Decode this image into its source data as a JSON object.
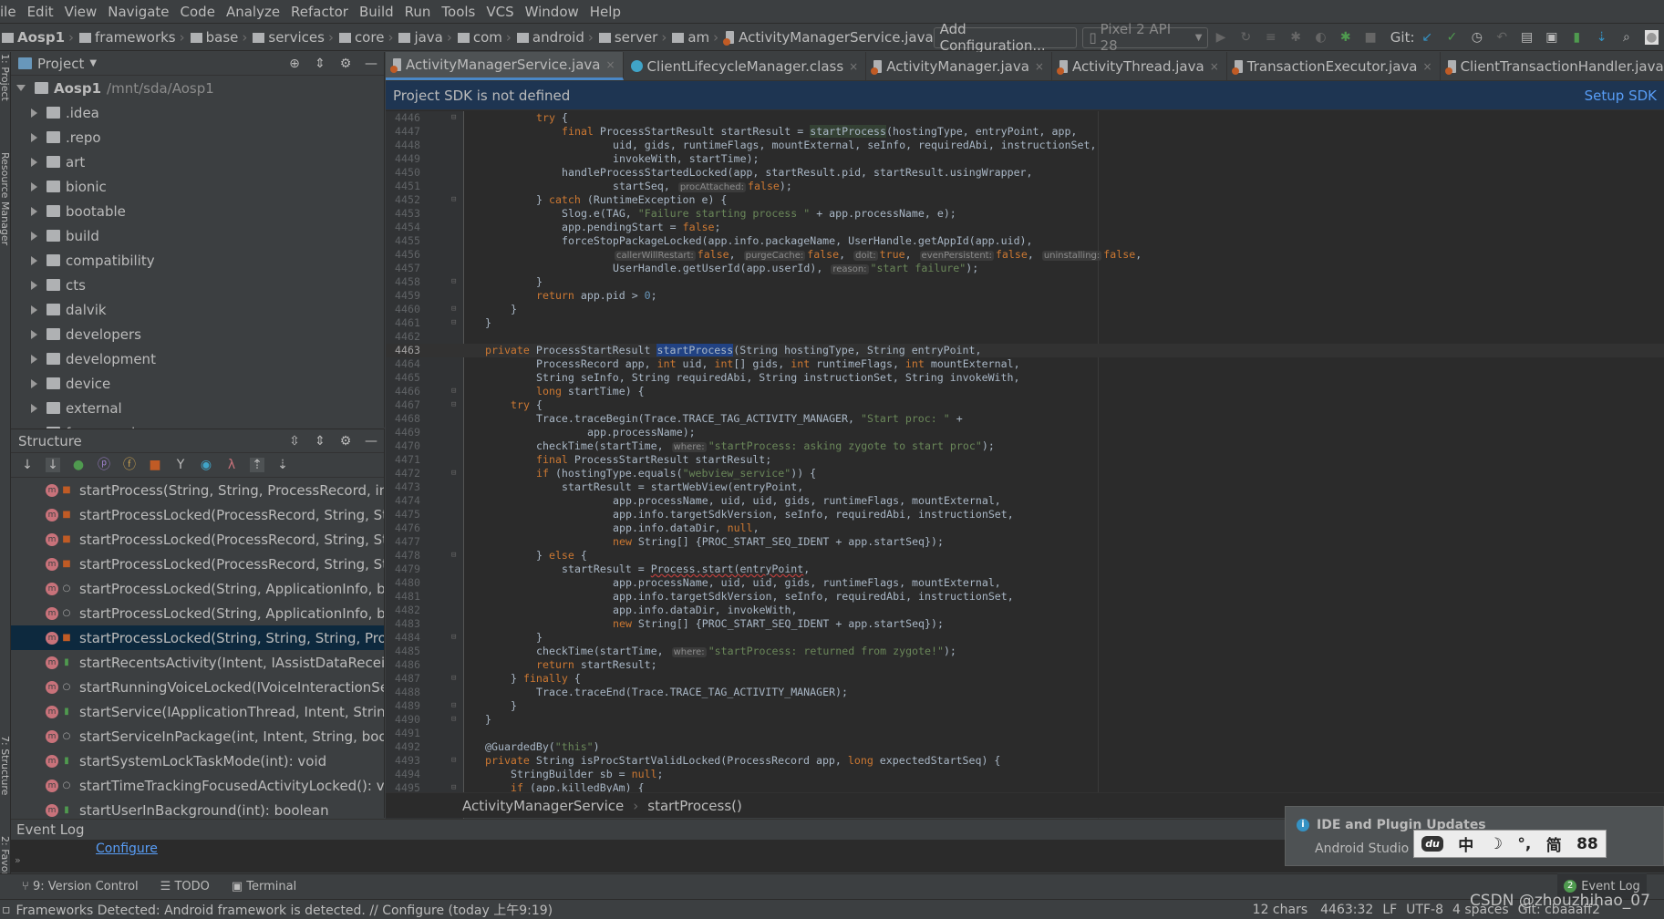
{
  "menu": [
    "ile",
    "Edit",
    "View",
    "Navigate",
    "Code",
    "Analyze",
    "Refactor",
    "Build",
    "Run",
    "Tools",
    "VCS",
    "Window",
    "Help"
  ],
  "breadcrumb": [
    "Aosp1",
    "frameworks",
    "base",
    "services",
    "core",
    "java",
    "com",
    "android",
    "server",
    "am",
    "ActivityManagerService.java"
  ],
  "toolbar": {
    "add_config": "Add Configuration...",
    "device": "Pixel 2 API 28",
    "git_label": "Git:"
  },
  "side_labels": [
    "1: Project",
    "Resource Manager",
    "7: Structure",
    "2: Favorites"
  ],
  "project": {
    "title": "Project",
    "root": "Aosp1",
    "root_path": "/mnt/sda/Aosp1",
    "items": [
      ".idea",
      ".repo",
      "art",
      "bionic",
      "bootable",
      "build",
      "compatibility",
      "cts",
      "dalvik",
      "developers",
      "development",
      "device",
      "external",
      "frameworks"
    ]
  },
  "structure": {
    "title": "Structure",
    "items": [
      {
        "label": "startProcess(String, String, ProcessRecord, int, int[], int, int, String",
        "vis": "private"
      },
      {
        "label": "startProcessLocked(ProcessRecord, String, String",
        "vis": "private"
      },
      {
        "label": "startProcessLocked(ProcessRecord, String, String",
        "vis": "private"
      },
      {
        "label": "startProcessLocked(ProcessRecord, String, String",
        "vis": "private"
      },
      {
        "label": "startProcessLocked(String, ApplicationInfo, boolean",
        "vis": "package"
      },
      {
        "label": "startProcessLocked(String, ApplicationInfo, boolean",
        "vis": "package"
      },
      {
        "label": "startProcessLocked(String, String, String, ProcessRecord",
        "vis": "private",
        "selected": true
      },
      {
        "label": "startRecentsActivity(Intent, IAssistDataReceiver, ",
        "vis": "public"
      },
      {
        "label": "startRunningVoiceLocked(IVoiceInteractionSession",
        "vis": "package"
      },
      {
        "label": "startService(IApplicationThread, Intent, String, boolean",
        "vis": "public"
      },
      {
        "label": "startServiceInPackage(int, Intent, String, boolean",
        "vis": "package"
      },
      {
        "label": "startSystemLockTaskMode(int): void",
        "vis": "public"
      },
      {
        "label": "startTimeTrackingFocusedActivityLocked(): void",
        "vis": "package"
      },
      {
        "label": "startUserInBackground(int): boolean",
        "vis": "public"
      }
    ]
  },
  "tabs": [
    {
      "label": "ActivityManagerService.java",
      "active": true,
      "icon": "java"
    },
    {
      "label": "ClientLifecycleManager.class",
      "icon": "class"
    },
    {
      "label": "ActivityManager.java",
      "icon": "java"
    },
    {
      "label": "ActivityThread.java",
      "icon": "java"
    },
    {
      "label": "TransactionExecutor.java",
      "icon": "java"
    },
    {
      "label": "ClientTransactionHandler.java",
      "icon": "java"
    }
  ],
  "banner": {
    "text": "Project SDK is not defined",
    "action": "Setup SDK"
  },
  "code": {
    "current_line": 4463,
    "lines": [
      {
        "n": 4446,
        "i": 8,
        "t": [
          [
            "k",
            "try"
          ],
          [
            "p",
            " {"
          ]
        ]
      },
      {
        "n": 4447,
        "i": 12,
        "t": [
          [
            "k",
            "final"
          ],
          [
            "p",
            " ProcessStartResult startResult = "
          ],
          [
            "u",
            "startProcess"
          ],
          [
            "p",
            "(hostingType, entryPoint, app,"
          ]
        ]
      },
      {
        "n": 4448,
        "i": 20,
        "t": [
          [
            "p",
            "uid, gids, runtimeFlags, mountExternal, seInfo, requiredAbi, instructionSet,"
          ]
        ]
      },
      {
        "n": 4449,
        "i": 20,
        "t": [
          [
            "p",
            "invokeWith, startTime);"
          ]
        ]
      },
      {
        "n": 4450,
        "i": 12,
        "t": [
          [
            "p",
            "handleProcessStartedLocked(app, startResult.pid, startResult.usingWrapper,"
          ]
        ]
      },
      {
        "n": 4451,
        "i": 20,
        "t": [
          [
            "p",
            "startSeq, "
          ],
          [
            "h",
            "procAttached:"
          ],
          [
            "k",
            "false"
          ],
          [
            "p",
            ");"
          ]
        ]
      },
      {
        "n": 4452,
        "i": 8,
        "t": [
          [
            "p",
            "} "
          ],
          [
            "k",
            "catch"
          ],
          [
            "p",
            " (RuntimeException e) {"
          ]
        ]
      },
      {
        "n": 4453,
        "i": 12,
        "t": [
          [
            "p",
            "Slog.e(TAG, "
          ],
          [
            "s",
            "\"Failure starting process \""
          ],
          [
            "p",
            " + app.processName, e);"
          ]
        ]
      },
      {
        "n": 4454,
        "i": 12,
        "t": [
          [
            "p",
            "app.pendingStart = "
          ],
          [
            "k",
            "false"
          ],
          [
            "p",
            ";"
          ]
        ]
      },
      {
        "n": 4455,
        "i": 12,
        "t": [
          [
            "p",
            "forceStopPackageLocked(app.info.packageName, UserHandle.getAppId(app.uid),"
          ]
        ]
      },
      {
        "n": 4456,
        "i": 20,
        "t": [
          [
            "h",
            "callerWillRestart:"
          ],
          [
            "k",
            "false"
          ],
          [
            "p",
            ", "
          ],
          [
            "h",
            "purgeCache:"
          ],
          [
            "k",
            "false"
          ],
          [
            "p",
            ", "
          ],
          [
            "h",
            "doit:"
          ],
          [
            "k",
            "true"
          ],
          [
            "p",
            ", "
          ],
          [
            "h",
            "evenPersistent:"
          ],
          [
            "k",
            "false"
          ],
          [
            "p",
            ", "
          ],
          [
            "h",
            "uninstalling:"
          ],
          [
            "k",
            "false"
          ],
          [
            "p",
            ","
          ]
        ]
      },
      {
        "n": 4457,
        "i": 20,
        "t": [
          [
            "p",
            "UserHandle.getUserId(app.userId), "
          ],
          [
            "h",
            "reason:"
          ],
          [
            "s",
            "\"start failure\""
          ],
          [
            "p",
            ");"
          ]
        ]
      },
      {
        "n": 4458,
        "i": 8,
        "t": [
          [
            "p",
            "}"
          ]
        ]
      },
      {
        "n": 4459,
        "i": 8,
        "t": [
          [
            "k",
            "return"
          ],
          [
            "p",
            " app.pid > "
          ],
          [
            "n",
            "0"
          ],
          [
            "p",
            ";"
          ]
        ]
      },
      {
        "n": 4460,
        "i": 4,
        "t": [
          [
            "p",
            "}"
          ]
        ]
      },
      {
        "n": 4461,
        "i": 0,
        "t": [
          [
            "p",
            "}"
          ]
        ]
      },
      {
        "n": 4462,
        "i": 0,
        "t": []
      },
      {
        "n": 4463,
        "i": 0,
        "t": [
          [
            "k",
            "private"
          ],
          [
            "p",
            " ProcessStartResult "
          ],
          [
            "sel",
            "startProcess"
          ],
          [
            "p",
            "(String hostingType, String entryPoint,"
          ]
        ]
      },
      {
        "n": 4464,
        "i": 8,
        "t": [
          [
            "p",
            "ProcessRecord app, "
          ],
          [
            "k",
            "int"
          ],
          [
            "p",
            " uid, "
          ],
          [
            "k",
            "int"
          ],
          [
            "p",
            "[] gids, "
          ],
          [
            "k",
            "int"
          ],
          [
            "p",
            " runtimeFlags, "
          ],
          [
            "k",
            "int"
          ],
          [
            "p",
            " mountExternal,"
          ]
        ]
      },
      {
        "n": 4465,
        "i": 8,
        "t": [
          [
            "p",
            "String seInfo, String requiredAbi, String instructionSet, String invokeWith,"
          ]
        ]
      },
      {
        "n": 4466,
        "i": 8,
        "t": [
          [
            "k",
            "long"
          ],
          [
            "p",
            " startTime) {"
          ]
        ]
      },
      {
        "n": 4467,
        "i": 4,
        "t": [
          [
            "k",
            "try"
          ],
          [
            "p",
            " {"
          ]
        ]
      },
      {
        "n": 4468,
        "i": 8,
        "t": [
          [
            "p",
            "Trace.traceBegin(Trace.TRACE_TAG_ACTIVITY_MANAGER, "
          ],
          [
            "s",
            "\"Start proc: \""
          ],
          [
            "p",
            " +"
          ]
        ]
      },
      {
        "n": 4469,
        "i": 16,
        "t": [
          [
            "p",
            "app.processName);"
          ]
        ]
      },
      {
        "n": 4470,
        "i": 8,
        "t": [
          [
            "p",
            "checkTime(startTime, "
          ],
          [
            "h",
            "where:"
          ],
          [
            "s",
            "\"startProcess: asking zygote to start proc\""
          ],
          [
            "p",
            ");"
          ]
        ]
      },
      {
        "n": 4471,
        "i": 8,
        "t": [
          [
            "k",
            "final"
          ],
          [
            "p",
            " ProcessStartResult startResult;"
          ]
        ]
      },
      {
        "n": 4472,
        "i": 8,
        "t": [
          [
            "k",
            "if"
          ],
          [
            "p",
            " (hostingType.equals("
          ],
          [
            "s",
            "\"webview_service\""
          ],
          [
            "p",
            ")) {"
          ]
        ]
      },
      {
        "n": 4473,
        "i": 12,
        "t": [
          [
            "p",
            "startResult = startWebView(entryPoint,"
          ]
        ]
      },
      {
        "n": 4474,
        "i": 20,
        "t": [
          [
            "p",
            "app.processName, uid, uid, gids, runtimeFlags, mountExternal,"
          ]
        ]
      },
      {
        "n": 4475,
        "i": 20,
        "t": [
          [
            "p",
            "app.info.targetSdkVersion, seInfo, requiredAbi, instructionSet,"
          ]
        ]
      },
      {
        "n": 4476,
        "i": 20,
        "t": [
          [
            "p",
            "app.info.dataDir, "
          ],
          [
            "k",
            "null"
          ],
          [
            "p",
            ","
          ]
        ]
      },
      {
        "n": 4477,
        "i": 20,
        "t": [
          [
            "k",
            "new"
          ],
          [
            "p",
            " String[] {PROC_START_SEQ_IDENT + app.startSeq});"
          ]
        ]
      },
      {
        "n": 4478,
        "i": 8,
        "t": [
          [
            "p",
            "} "
          ],
          [
            "k",
            "else"
          ],
          [
            "p",
            " {"
          ]
        ]
      },
      {
        "n": 4479,
        "i": 12,
        "t": [
          [
            "p",
            "startResult = "
          ],
          [
            "err",
            "Process.start(entryPoint"
          ],
          [
            "p",
            ","
          ]
        ]
      },
      {
        "n": 4480,
        "i": 20,
        "t": [
          [
            "p",
            "app.processName, uid, uid, gids, runtimeFlags, mountExternal,"
          ]
        ]
      },
      {
        "n": 4481,
        "i": 20,
        "t": [
          [
            "p",
            "app.info.targetSdkVersion, seInfo, requiredAbi, instructionSet,"
          ]
        ]
      },
      {
        "n": 4482,
        "i": 20,
        "t": [
          [
            "p",
            "app.info.dataDir, invokeWith,"
          ]
        ]
      },
      {
        "n": 4483,
        "i": 20,
        "t": [
          [
            "k",
            "new"
          ],
          [
            "p",
            " String[] {PROC_START_SEQ_IDENT + app.startSeq});"
          ]
        ]
      },
      {
        "n": 4484,
        "i": 8,
        "t": [
          [
            "p",
            "}"
          ]
        ]
      },
      {
        "n": 4485,
        "i": 8,
        "t": [
          [
            "p",
            "checkTime(startTime, "
          ],
          [
            "h",
            "where:"
          ],
          [
            "s",
            "\"startProcess: returned from zygote!\""
          ],
          [
            "p",
            ");"
          ]
        ]
      },
      {
        "n": 4486,
        "i": 8,
        "t": [
          [
            "k",
            "return"
          ],
          [
            "p",
            " startResult;"
          ]
        ]
      },
      {
        "n": 4487,
        "i": 4,
        "t": [
          [
            "p",
            "} "
          ],
          [
            "k",
            "finally"
          ],
          [
            "p",
            " {"
          ]
        ]
      },
      {
        "n": 4488,
        "i": 8,
        "t": [
          [
            "p",
            "Trace.traceEnd(Trace.TRACE_TAG_ACTIVITY_MANAGER);"
          ]
        ]
      },
      {
        "n": 4489,
        "i": 4,
        "t": [
          [
            "p",
            "}"
          ]
        ]
      },
      {
        "n": 4490,
        "i": 0,
        "t": [
          [
            "p",
            "}"
          ]
        ]
      },
      {
        "n": 4491,
        "i": 0,
        "t": []
      },
      {
        "n": 4492,
        "i": 0,
        "t": [
          [
            "p",
            "@GuardedBy("
          ],
          [
            "s",
            "\"this\""
          ],
          [
            "p",
            ")"
          ]
        ]
      },
      {
        "n": 4493,
        "i": 0,
        "t": [
          [
            "k",
            "private"
          ],
          [
            "p",
            " String isProcStartValidLocked(ProcessRecord app, "
          ],
          [
            "k",
            "long"
          ],
          [
            "p",
            " expectedStartSeq) {"
          ]
        ]
      },
      {
        "n": 4494,
        "i": 4,
        "t": [
          [
            "p",
            "StringBuilder sb = "
          ],
          [
            "k",
            "null"
          ],
          [
            "p",
            ";"
          ]
        ]
      },
      {
        "n": 4495,
        "i": 4,
        "t": [
          [
            "k",
            "if"
          ],
          [
            "p",
            " (app.killedByAm) {"
          ]
        ]
      }
    ]
  },
  "editor_breadcrumb": [
    "ActivityManagerService",
    "startProcess()"
  ],
  "event_log": {
    "title": "Event Log",
    "link": "Configure"
  },
  "bottom_tools": [
    "9: Version Control",
    "TODO",
    "Terminal"
  ],
  "event_log_button": {
    "label": "Event Log",
    "count": "2"
  },
  "notification": {
    "title": "IDE and Plugin Updates",
    "body": "Android Studio i"
  },
  "ime": [
    "中",
    "☽",
    "°,",
    "简",
    "88"
  ],
  "status": {
    "message": "Frameworks Detected: Android framework is detected. // Configure (today 上午9:19)",
    "chars": "12 chars",
    "position": "4463:32",
    "line_sep": "LF",
    "encoding": "UTF-8",
    "indent": "4 spaces",
    "git": "Git: cbaaaff2"
  },
  "watermark": "CSDN @zhouzhihao_07",
  "colors": {
    "keyword": "#cc7832",
    "string": "#6a8759",
    "number": "#6897bb",
    "editor_bg": "#2b2b2b",
    "accent": "#4a88c7",
    "link": "#589df6"
  }
}
